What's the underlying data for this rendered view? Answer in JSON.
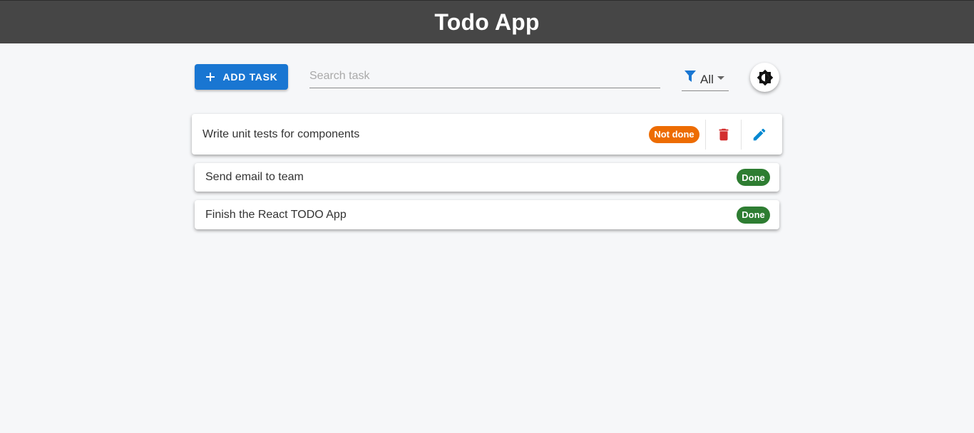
{
  "app": {
    "title": "Todo App"
  },
  "toolbar": {
    "add_label": "ADD TASK",
    "search_placeholder": "Search task",
    "search_value": "",
    "filter_value": "All"
  },
  "tasks": [
    {
      "title": "Write unit tests for components",
      "status": "Not done"
    },
    {
      "title": "Send email to team",
      "status": "Done"
    },
    {
      "title": "Finish the React TODO App",
      "status": "Done"
    }
  ],
  "colors": {
    "appbar": "#464646",
    "primary": "#1976d2",
    "not_done": "#ed6c02",
    "done": "#2e7d32",
    "delete": "#d32f2f",
    "edit": "#0288d1"
  },
  "icons": {
    "add": "plus-icon",
    "filter": "filter-icon",
    "theme": "brightness-icon",
    "delete": "trash-icon",
    "edit": "pencil-icon"
  }
}
